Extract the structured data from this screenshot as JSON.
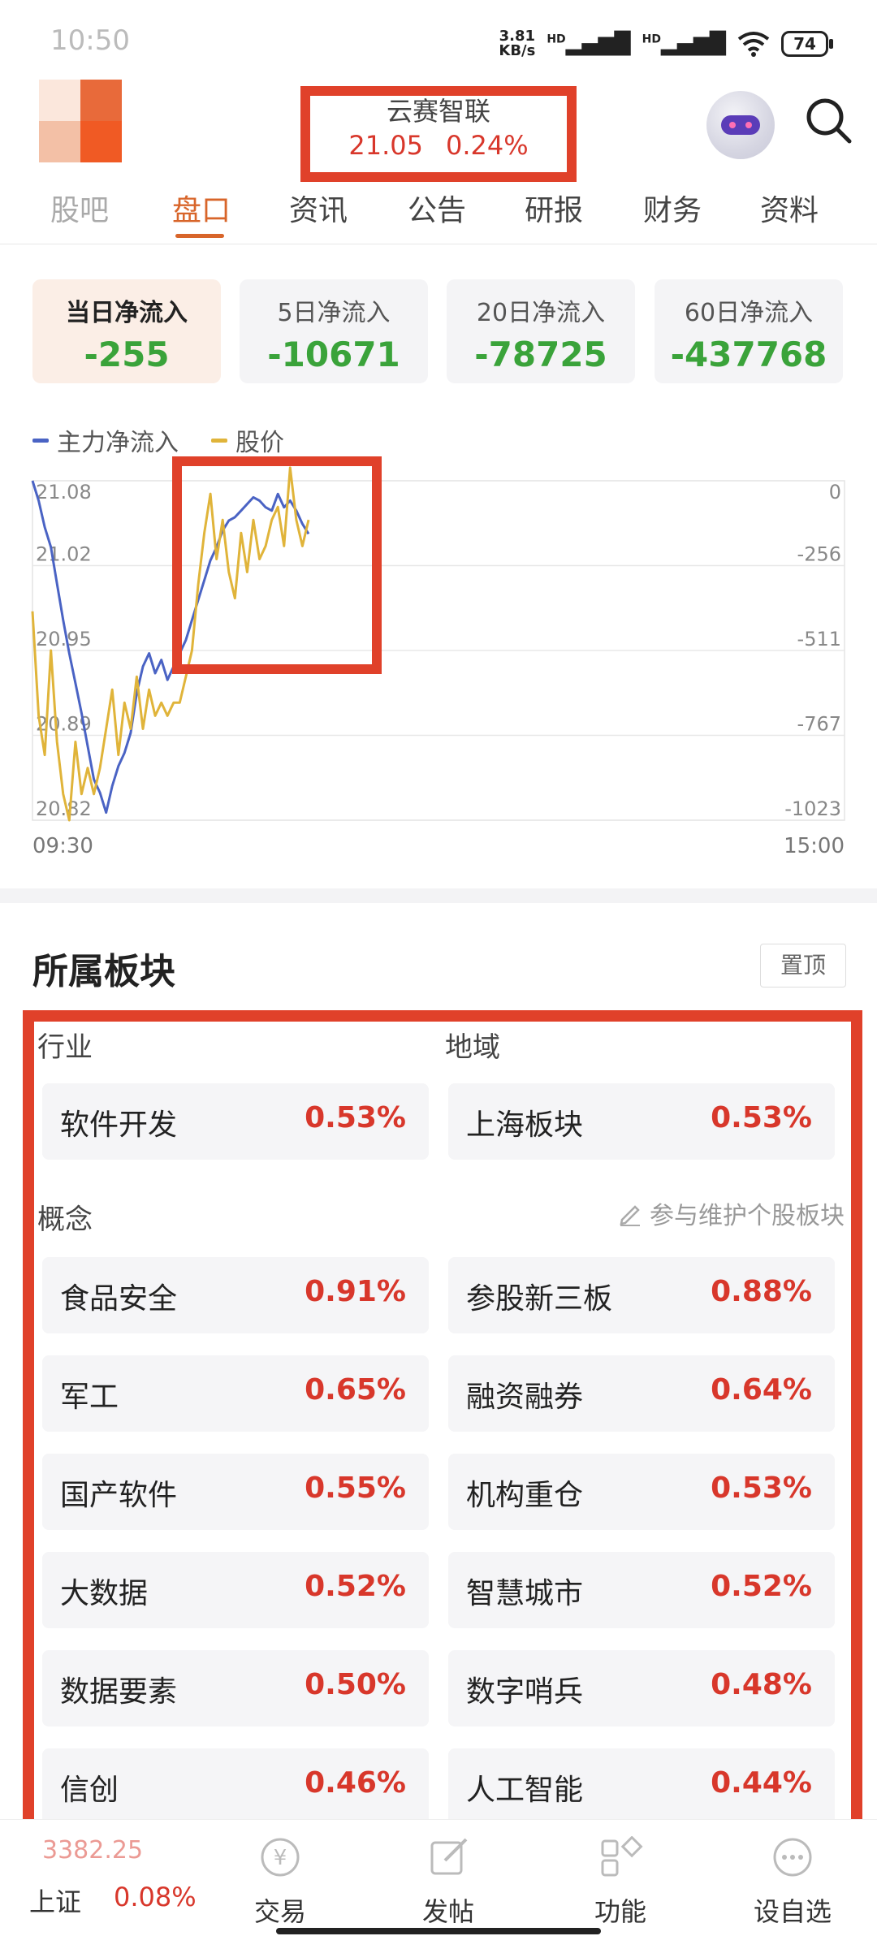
{
  "status_bar": {
    "time": "10:50",
    "net_speed_value": "3.81",
    "net_speed_unit": "KB/s",
    "signal1": "HD",
    "signal2": "HD",
    "battery": "74"
  },
  "header": {
    "stock_name": "云赛智联",
    "price": "21.05",
    "change_pct": "0.24%"
  },
  "tabs": [
    {
      "label": "股吧"
    },
    {
      "label": "盘口",
      "active": true
    },
    {
      "label": "资讯"
    },
    {
      "label": "公告"
    },
    {
      "label": "研报"
    },
    {
      "label": "财务"
    },
    {
      "label": "资料"
    }
  ],
  "inflow_cards": [
    {
      "label": "当日净流入",
      "value": "-255",
      "active": true
    },
    {
      "label": "5日净流入",
      "value": "-10671"
    },
    {
      "label": "20日净流入",
      "value": "-78725"
    },
    {
      "label": "60日净流入",
      "value": "-437768"
    }
  ],
  "legend": {
    "main_flow": "主力净流入",
    "price": "股价",
    "main_flow_color": "#4a63c4",
    "price_color": "#e0b43a"
  },
  "chart_data": {
    "type": "line",
    "x_start": "09:30",
    "x_end": "15:00",
    "left_axis_ticks": [
      "21.08",
      "21.02",
      "20.95",
      "20.89",
      "20.82"
    ],
    "right_axis_ticks": [
      "0",
      "-256",
      "-511",
      "-767",
      "-1023"
    ],
    "left_ylim": [
      20.82,
      21.08
    ],
    "right_ylim": [
      -1023,
      0
    ],
    "grid": true,
    "series": [
      {
        "name": "主力净流入",
        "axis": "right",
        "color": "#4a63c4",
        "values": [
          0,
          -60,
          -140,
          -200,
          -310,
          -420,
          -520,
          -610,
          -700,
          -800,
          -900,
          -940,
          -1000,
          -920,
          -860,
          -820,
          -760,
          -640,
          -560,
          -520,
          -580,
          -540,
          -600,
          -560,
          -520,
          -480,
          -420,
          -360,
          -300,
          -240,
          -200,
          -150,
          -120,
          -110,
          -90,
          -70,
          -50,
          -60,
          -80,
          -90,
          -40,
          -80,
          -60,
          -90,
          -130,
          -160
        ]
      },
      {
        "name": "股价",
        "axis": "left",
        "color": "#e0b43a",
        "values": [
          20.98,
          20.9,
          20.87,
          20.95,
          20.88,
          20.84,
          20.82,
          20.88,
          20.84,
          20.86,
          20.84,
          20.86,
          20.89,
          20.92,
          20.87,
          20.91,
          20.89,
          20.93,
          20.89,
          20.92,
          20.9,
          20.91,
          20.9,
          20.91,
          20.91,
          20.93,
          20.95,
          21.0,
          21.04,
          21.07,
          21.02,
          21.05,
          21.01,
          20.99,
          21.04,
          21.01,
          21.05,
          21.02,
          21.03,
          21.05,
          21.06,
          21.03,
          21.09,
          21.05,
          21.03,
          21.05
        ]
      }
    ]
  },
  "sector_section": {
    "title": "所属板块",
    "pin_label": "置顶",
    "industry_label": "行业",
    "region_label": "地域",
    "concept_label": "概念",
    "maintain_label": "参与维护个股板块",
    "industry": {
      "name": "软件开发",
      "pct": "0.53%"
    },
    "region": {
      "name": "上海板块",
      "pct": "0.53%"
    },
    "concepts": [
      {
        "name": "食品安全",
        "pct": "0.91%"
      },
      {
        "name": "参股新三板",
        "pct": "0.88%"
      },
      {
        "name": "军工",
        "pct": "0.65%"
      },
      {
        "name": "融资融券",
        "pct": "0.64%"
      },
      {
        "name": "国产软件",
        "pct": "0.55%"
      },
      {
        "name": "机构重仓",
        "pct": "0.53%"
      },
      {
        "name": "大数据",
        "pct": "0.52%"
      },
      {
        "name": "智慧城市",
        "pct": "0.52%"
      },
      {
        "name": "数据要素",
        "pct": "0.50%"
      },
      {
        "name": "数字哨兵",
        "pct": "0.48%"
      },
      {
        "name": "信创",
        "pct": "0.46%"
      },
      {
        "name": "人工智能",
        "pct": "0.44%"
      }
    ]
  },
  "bottom_nav": {
    "index_value": "3382.25",
    "index_name": "上证",
    "index_pct": "0.08%",
    "items": [
      {
        "label": "交易",
        "icon": "yen-circle-icon"
      },
      {
        "label": "发帖",
        "icon": "edit-icon"
      },
      {
        "label": "功能",
        "icon": "grid-icon"
      },
      {
        "label": "设自选",
        "icon": "more-icon"
      }
    ]
  }
}
